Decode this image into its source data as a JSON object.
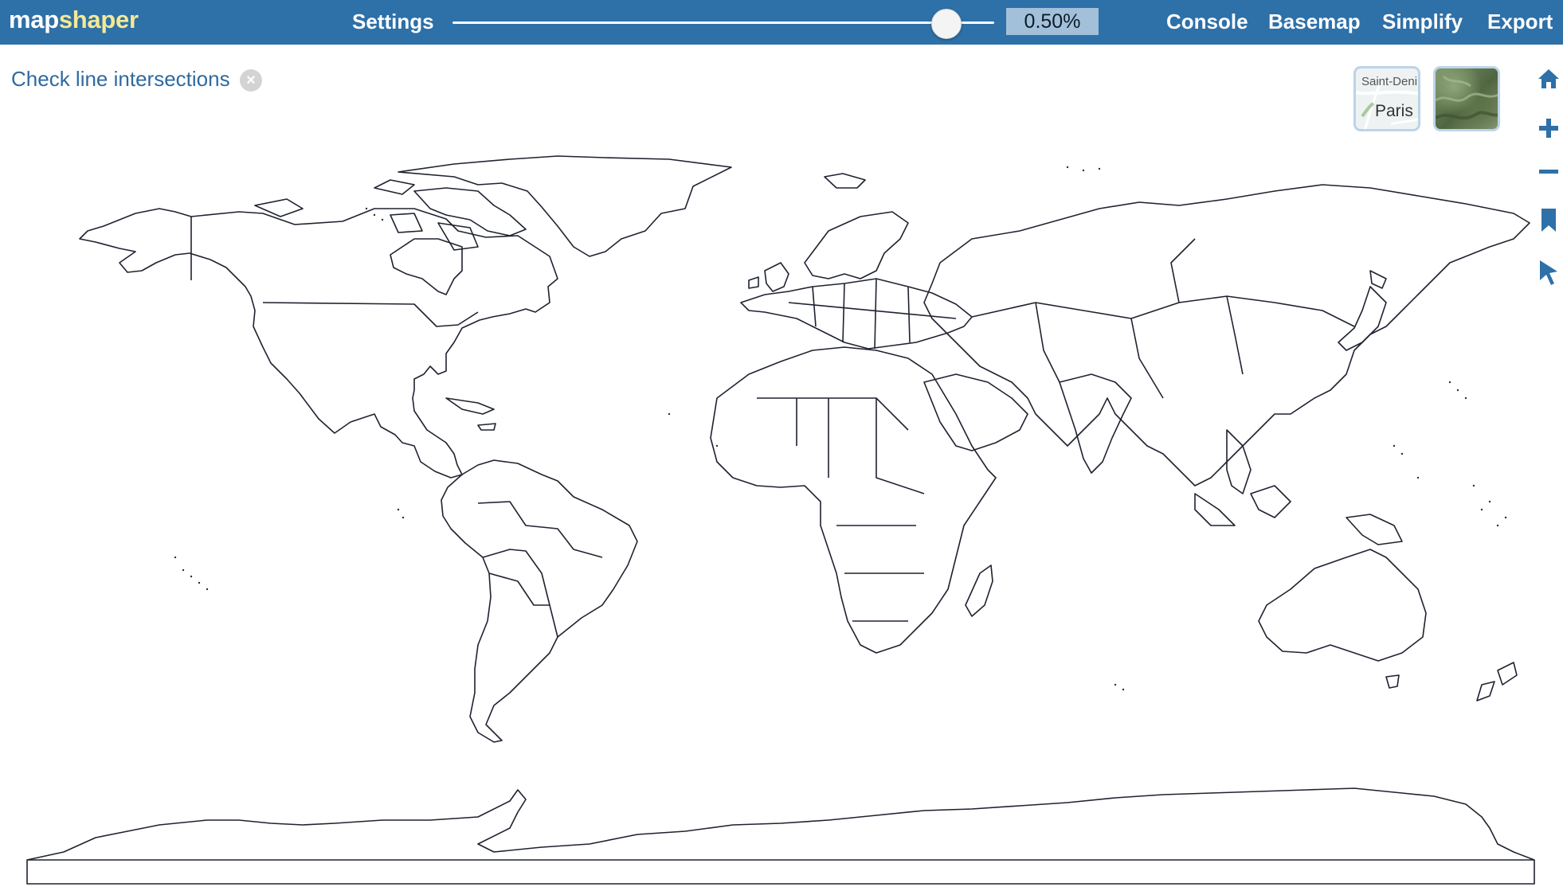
{
  "app": {
    "logo_part1": "map",
    "logo_part2": "shaper"
  },
  "menu": {
    "settings": "Settings",
    "console": "Console",
    "basemap": "Basemap",
    "simplify": "Simplify",
    "export": "Export"
  },
  "simplify": {
    "percent_label": "0.50%",
    "slider_value": 0.91
  },
  "intersections": {
    "label": "Check line intersections",
    "close_symbol": "×"
  },
  "basemaps": {
    "streets_label_top": "Saint-Deni",
    "streets_label_city": "Paris"
  },
  "tools": [
    "home-icon",
    "zoom-in-icon",
    "zoom-out-icon",
    "bookmark-icon",
    "pointer-select-icon"
  ],
  "colors": {
    "header": "#2e70a8",
    "logo_accent": "#f3e996",
    "outline": "#1f2230",
    "label": "#2e6aa0"
  }
}
